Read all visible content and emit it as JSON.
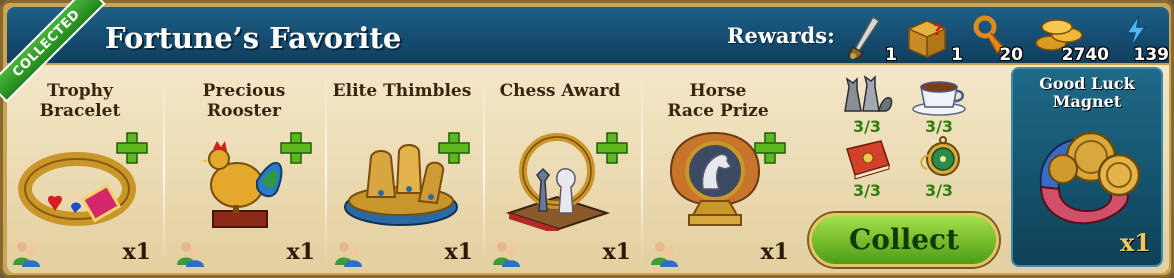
{
  "header": {
    "title": "Fortune’s Favorite",
    "ribbon": "COLLECTED",
    "rewards_label": "Rewards:"
  },
  "rewards": [
    {
      "icon": "dagger-icon",
      "count": "1"
    },
    {
      "icon": "mystery-chest-icon",
      "count": "1"
    },
    {
      "icon": "key-icon",
      "count": "20"
    },
    {
      "icon": "coins-icon",
      "count": "2740"
    },
    {
      "icon": "energy-bolt-icon",
      "count": "139"
    }
  ],
  "items": [
    {
      "name": "Trophy Bracelet",
      "qty": "x1"
    },
    {
      "name": "Precious Rooster",
      "qty": "x1"
    },
    {
      "name": "Elite Thimbles",
      "qty": "x1"
    },
    {
      "name": "Chess Award",
      "qty": "x1"
    },
    {
      "name": "Horse Race Prize",
      "qty": "x1"
    }
  ],
  "collections": [
    {
      "icon": "cats-figurine-icon",
      "count": "3/3"
    },
    {
      "icon": "teacup-icon",
      "count": "3/3"
    },
    {
      "icon": "red-book-icon",
      "count": "3/3"
    },
    {
      "icon": "pocket-watch-icon",
      "count": "3/3"
    }
  ],
  "collect_button": "Collect",
  "final_reward": {
    "name": "Good Luck Magnet",
    "qty": "x1"
  },
  "colors": {
    "header": "#1a5477",
    "accent_green": "#5aa91f",
    "panel": "#efe1bf"
  }
}
